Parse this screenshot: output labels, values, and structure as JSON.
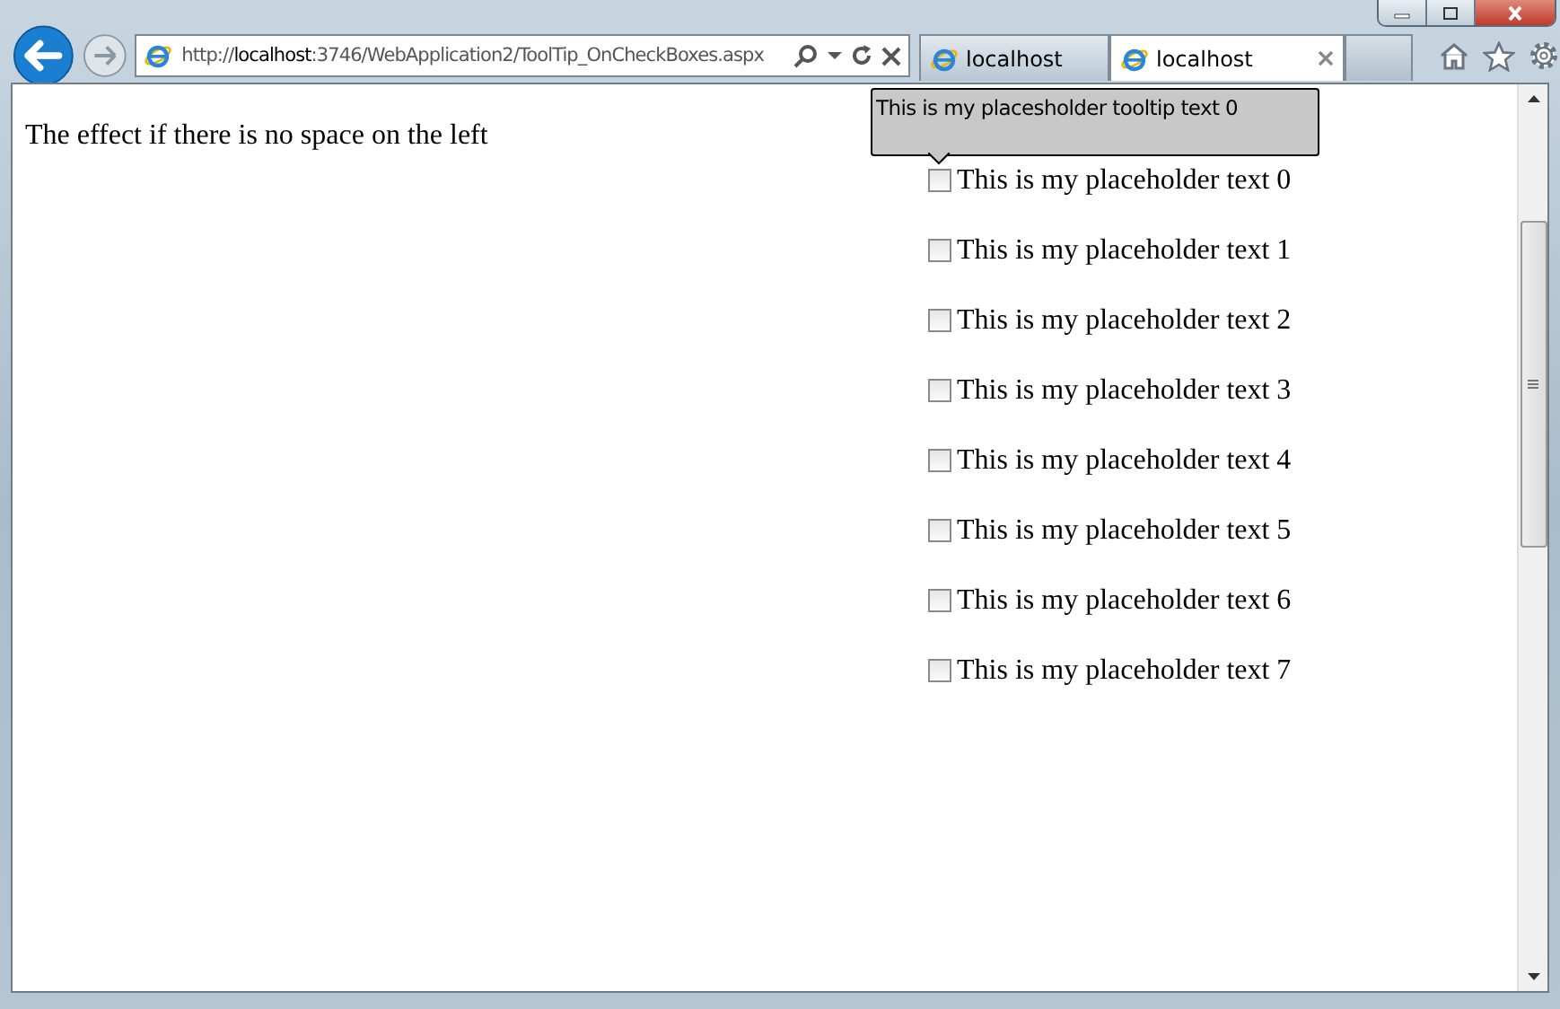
{
  "browser": {
    "address": "http://**localhost**:3746/WebApplication2/ToolTip_OnCheckBoxes.aspx",
    "tabs": [
      {
        "label": "localhost",
        "selected": false
      },
      {
        "label": "localhost",
        "selected": true
      }
    ]
  },
  "page": {
    "heading": "The effect if there is no space on the left",
    "checkboxes": [
      {
        "label": "This is my placeholder text 0",
        "checked": false
      },
      {
        "label": "This is my placeholder text 1",
        "checked": false
      },
      {
        "label": "This is my placeholder text 2",
        "checked": false
      },
      {
        "label": "This is my placeholder text 3",
        "checked": false
      },
      {
        "label": "This is my placeholder text 4",
        "checked": false
      },
      {
        "label": "This is my placeholder text 5",
        "checked": false
      },
      {
        "label": "This is my placeholder text 6",
        "checked": false
      },
      {
        "label": "This is my placeholder text 7",
        "checked": false
      }
    ],
    "tooltip": {
      "text": "This is my placesholder tooltip text 0"
    }
  }
}
